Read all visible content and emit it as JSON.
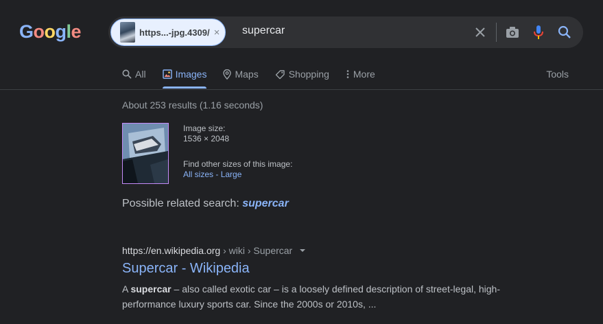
{
  "logo": {
    "letters": [
      "G",
      "o",
      "o",
      "g",
      "l",
      "e"
    ],
    "colors": [
      "#8ab4f8",
      "#f28b82",
      "#fdd663",
      "#8ab4f8",
      "#81c995",
      "#f28b82"
    ]
  },
  "search": {
    "chip_label": "https...-jpg.4309/",
    "chip_close": "×",
    "query": "supercar",
    "icons": [
      "close-icon",
      "camera-icon",
      "microphone-icon",
      "search-icon"
    ]
  },
  "tabs": [
    {
      "label": "All",
      "icon": "search-icon"
    },
    {
      "label": "Images",
      "icon": "image-icon"
    },
    {
      "label": "Maps",
      "icon": "map-pin-icon"
    },
    {
      "label": "Shopping",
      "icon": "tag-icon"
    },
    {
      "label": "More",
      "icon": "more-vertical-icon"
    }
  ],
  "tools": "Tools",
  "stats": "About 253 results (1.16 seconds)",
  "image_info": {
    "size_label": "Image size:",
    "size_value": "1536 × 2048",
    "other_sizes_label": "Find other sizes of this image:",
    "all_sizes": "All sizes",
    "separator": " - ",
    "large": "Large"
  },
  "related": {
    "prefix": "Possible related search: ",
    "term": "supercar"
  },
  "result": {
    "domain": "https://en.wikipedia.org",
    "path": " › wiki › Supercar",
    "title": "Supercar - Wikipedia",
    "snippet_prefix": "A ",
    "snippet_bold": "supercar",
    "snippet_rest": " – also called exotic car – is a loosely defined description of street-legal, high-performance luxury sports car. Since the 2000s or 2010s, ..."
  },
  "colors": {
    "accent": "#8ab4f8",
    "background": "#202124",
    "visited_border": "#c58af9"
  }
}
